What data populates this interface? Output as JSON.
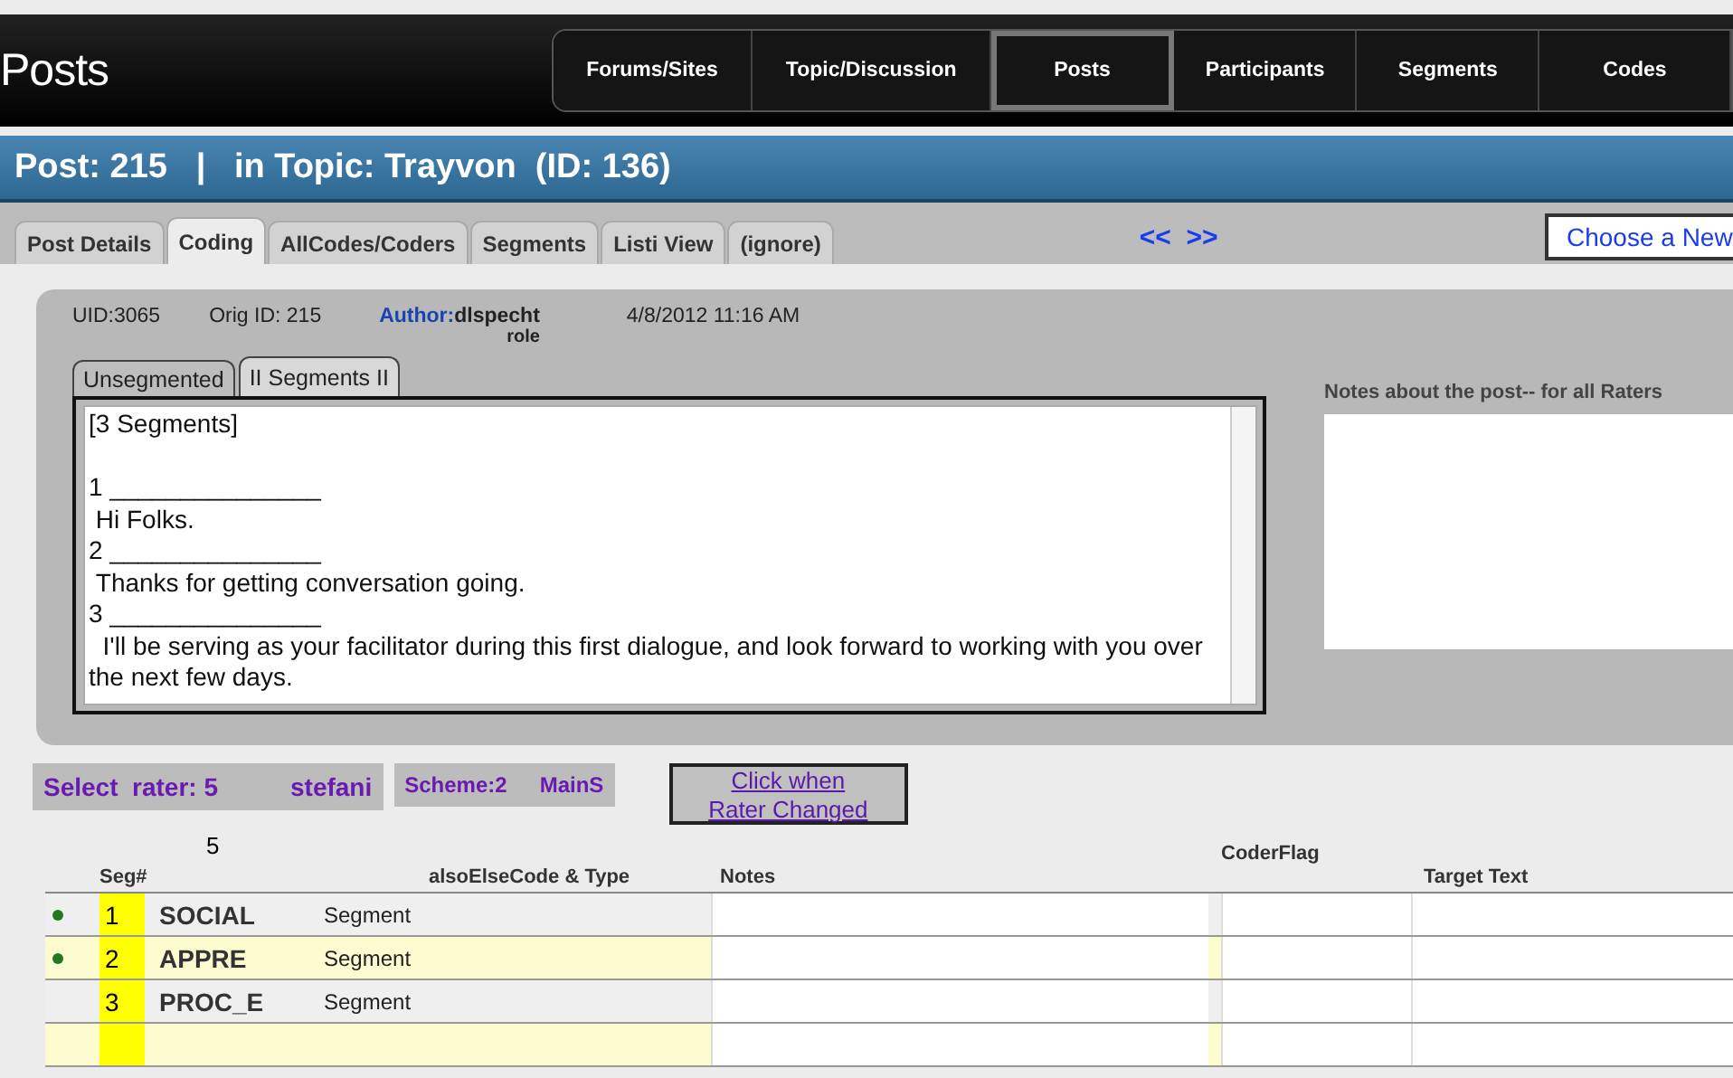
{
  "app_title": "Posts",
  "nav": [
    {
      "label": "Forums/Sites",
      "selected": false
    },
    {
      "label": "Topic/Discussion",
      "selected": false
    },
    {
      "label": "Posts",
      "selected": true
    },
    {
      "label": "Participants",
      "selected": false
    },
    {
      "label": "Segments",
      "selected": false
    },
    {
      "label": "Codes",
      "selected": false
    }
  ],
  "post_heading": "Post: 215   |   in Topic: Trayvon  (ID: 136)",
  "tabs": [
    {
      "label": "Post Details",
      "selected": false
    },
    {
      "label": "Coding",
      "selected": true
    },
    {
      "label": "AllCodes/Coders",
      "selected": false
    },
    {
      "label": "Segments",
      "selected": false
    },
    {
      "label": "Listi View",
      "selected": false
    },
    {
      "label": "(ignore)",
      "selected": false
    }
  ],
  "pager": "<<  >>",
  "choose_button": "Choose a New",
  "post_info": {
    "uid": "UID:3065",
    "orig_id": "Orig ID: 215",
    "author_label": "Author:",
    "author": "dlspecht",
    "role": "role",
    "date": "4/8/2012 11:16 AM"
  },
  "text_tabs": [
    {
      "label": "Unsegmented",
      "selected": false
    },
    {
      "label": "II Segments II",
      "selected": true
    }
  ],
  "segment_text": "[3 Segments]\n\n1 _______________\n Hi Folks.\n2 _______________\n Thanks for getting conversation going.\n3 _______________\n  I'll be serving as your facilitator during this first dialogue, and look forward to working with you over the next few days.",
  "notes_label": "Notes about the post-- for all Raters",
  "rater": {
    "label": "Select  rater: 5",
    "name": "stefani",
    "scheme": "Scheme:2",
    "scheme_name": "MainS",
    "button": [
      "Click when",
      "Rater Changed"
    ]
  },
  "table": {
    "count": "5",
    "columns": [
      "Seg#",
      "alsoElseCode & Type",
      "Notes",
      "CoderFlag",
      "Target Text"
    ],
    "rows": [
      {
        "seg": "1",
        "code": "SOCIAL",
        "type": "Segment",
        "flagged": true
      },
      {
        "seg": "2",
        "code": "APPRE",
        "type": "Segment",
        "flagged": true
      },
      {
        "seg": "3",
        "code": "PROC_E",
        "type": "Segment",
        "flagged": false
      }
    ]
  }
}
